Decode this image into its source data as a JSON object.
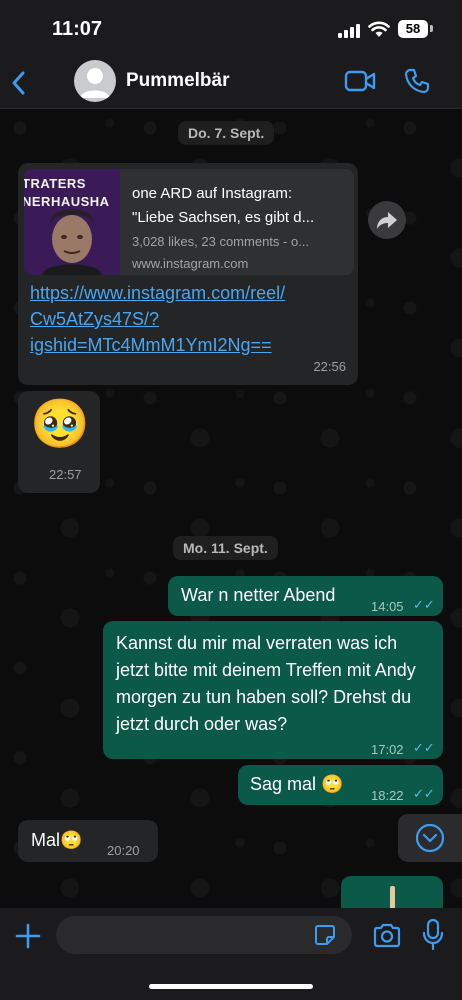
{
  "status_bar": {
    "time": "11:07",
    "battery": "58"
  },
  "header": {
    "contact_name": "Pummelbär"
  },
  "dates": [
    "Do. 7. Sept.",
    "Mo. 11. Sept."
  ],
  "link_message": {
    "preview_title": "one ARD auf Instagram:",
    "preview_subtitle": "\"Liebe Sachsen, es gibt d...",
    "preview_stats": "3,028 likes, 23 comments - o...",
    "preview_domain": "www.instagram.com",
    "thumb_text_1": "TRATERS",
    "thumb_text_2": "NERHAUSHA",
    "link_text": "https://www.instagram.com/reel/Cw5AtZys47S/?igshid=MTc4MmM1YmI2Ng==",
    "time": "22:56"
  },
  "emoji_message": {
    "emoji": "🥹",
    "time": "22:57"
  },
  "out_messages": [
    {
      "text": "War n netter Abend",
      "time": "14:05"
    },
    {
      "text": "Kannst du mir mal verraten was ich jetzt bitte mit deinem Treffen mit Andy morgen zu tun haben soll? Drehst du jetzt durch oder was?",
      "time": "17:02"
    },
    {
      "text": "Sag mal 🙄",
      "time": "18:22"
    }
  ],
  "in_message_2": {
    "text": "Mal🙄",
    "time": "20:20"
  },
  "input": {
    "placeholder": "",
    "value": ""
  },
  "icons": [
    "back-icon",
    "video-call-icon",
    "phone-icon",
    "share-icon",
    "scroll-down-icon",
    "plus-icon",
    "sticker-icon",
    "camera-icon",
    "mic-icon"
  ],
  "colors": {
    "accent": "#3e9cf0",
    "outgoing_bubble": "#0b5a49",
    "incoming_bubble": "#242526",
    "read_ticks": "#53bdeb"
  }
}
